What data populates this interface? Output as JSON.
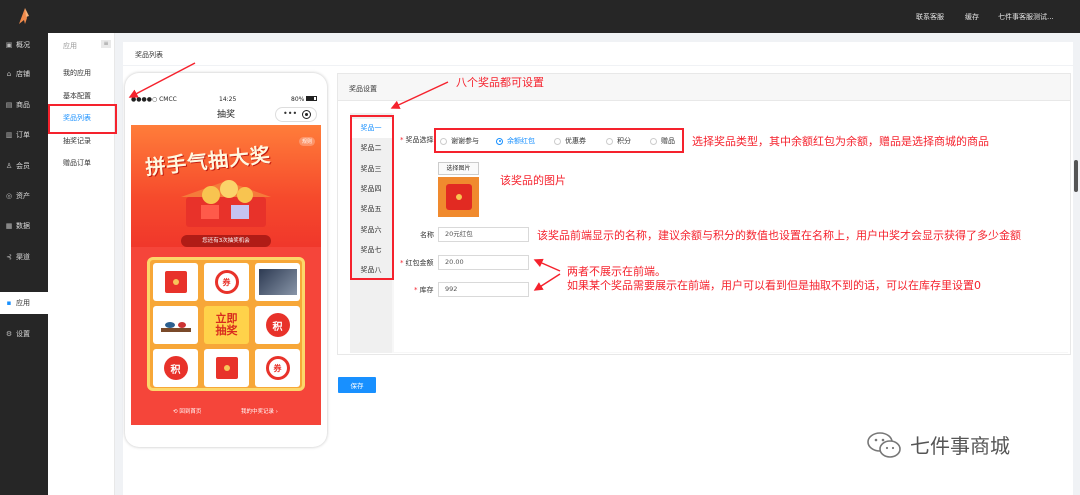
{
  "topbar": {
    "links": [
      "联系客服",
      "缓存",
      "七件事客服测试..."
    ]
  },
  "sidebar": {
    "items": [
      {
        "label": "概况",
        "icon": "dashboard-icon"
      },
      {
        "label": "店铺",
        "icon": "store-icon"
      },
      {
        "label": "商品",
        "icon": "goods-icon"
      },
      {
        "label": "订单",
        "icon": "order-icon"
      },
      {
        "label": "会员",
        "icon": "member-icon"
      },
      {
        "label": "资产",
        "icon": "asset-icon"
      },
      {
        "label": "数据",
        "icon": "data-icon"
      },
      {
        "label": "渠道",
        "icon": "channel-icon"
      },
      {
        "label": "应用",
        "icon": "apps-icon"
      },
      {
        "label": "设置",
        "icon": "settings-icon"
      }
    ],
    "active_index": 8
  },
  "subnav": {
    "heading": "应用",
    "items": [
      "我的应用",
      "基本配置",
      "奖品列表",
      "抽奖记录",
      "赠品订单"
    ],
    "active_index": 2
  },
  "breadcrumb": "奖品列表",
  "phone": {
    "status_left": "●●●●○ CMCC",
    "time": "14:25",
    "battery": "80%",
    "title": "抽奖",
    "banner_title": "拼手气抽大奖",
    "rule": "规则",
    "chances": "您还有3次抽奖机会",
    "cells": {
      "coupon": "券",
      "points": "积",
      "draw": "立即抽奖"
    },
    "back_home": "回到首页",
    "my_records": "我的中奖记录 ›"
  },
  "panel": {
    "title": "奖品设置",
    "tabs": [
      "奖品一",
      "奖品二",
      "奖品三",
      "奖品四",
      "奖品五",
      "奖品六",
      "奖品七",
      "奖品八"
    ],
    "active_tab": 0,
    "form": {
      "type_label": "奖品选择",
      "type_options": [
        "谢谢参与",
        "余额红包",
        "优惠券",
        "积分",
        "赠品"
      ],
      "type_selected": 1,
      "pic_button": "选择图片",
      "name_label": "名称",
      "name_value": "20元红包",
      "amount_label": "红包金额",
      "amount_value": "20.00",
      "stock_label": "库存",
      "stock_value": "992"
    },
    "save": "保存"
  },
  "annotations": {
    "all_prizes": "八个奖品都可设置",
    "type_note": "选择奖品类型，其中余额红包为余额，赠品是选择商城的商品",
    "pic_note": "该奖品的图片",
    "name_note": "该奖品前端显示的名称，建议余额与积分的数值也设置在名称上，用户中奖才会显示获得了多少金额",
    "hidden_note": "两者不展示在前端。",
    "stock_note": "如果某个奖品需要展示在前端，用户可以看到但是抽取不到的话，可以在库存里设置0"
  },
  "watermark": "七件事商城",
  "colors": {
    "accent": "#1890ff",
    "annotation": "#f5222d",
    "sidebar": "#262626"
  }
}
